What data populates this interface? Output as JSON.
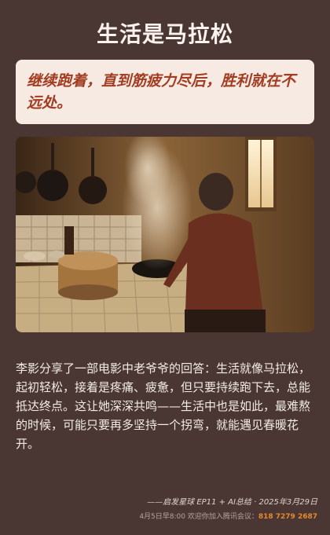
{
  "header": {
    "title": "生活是马拉松"
  },
  "quote": {
    "text": "继续跑着，直到筋疲力尽后，胜利就在不远处。"
  },
  "photo": {
    "alt": "老人在厨房灶台前做饭"
  },
  "content": {
    "paragraph": "李影分享了一部电影中老爷爷的回答：生活就像马拉松，起初轻松，接着是疼痛、疲惫，但只要持续跑下去，总能抵达终点。这让她深深共鸣——生活中也是如此，最难熬的时候，可能只要再多坚持一个拐弯，就能遇见春暖花开。"
  },
  "footer": {
    "credit": "——启发星球 EP11 + AI总结 · 2025年3月29日",
    "notice_prefix": "4月5日早8:00 欢迎你加入腾讯会议：",
    "meeting_id": "818 7279 2687"
  },
  "colors": {
    "background": "#4a3733",
    "quote_bg": "#f6eae2",
    "quote_text": "#a23d22",
    "accent": "#e8882e"
  }
}
